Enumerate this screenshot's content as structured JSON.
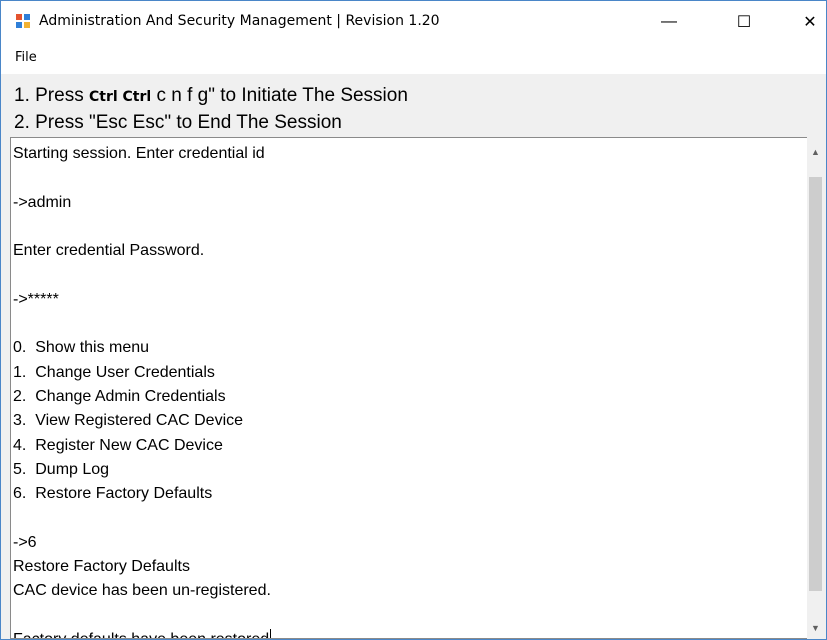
{
  "window": {
    "title": "Administration And Security Management  |  Revision 1.20",
    "icon": "app-window-icon",
    "controls": {
      "minimize": "—",
      "maximize": "☐",
      "close": "✕"
    }
  },
  "menu": {
    "file": "File"
  },
  "instructions": {
    "line1_prefix": "1. Press ",
    "line1_keys": "Ctrl Ctrl",
    "line1_suffix": " c n f g\" to Initiate The Session",
    "line2": "2. Press \"Esc Esc\" to End The Session"
  },
  "console": {
    "lines": [
      "Starting session. Enter credential id",
      "",
      "->admin",
      "",
      "Enter credential Password.",
      "",
      "->*****",
      "",
      "0.  Show this menu",
      "1.  Change User Credentials",
      "2.  Change Admin Credentials",
      "3.  View Registered CAC Device",
      "4.  Register New CAC Device",
      "5.  Dump Log",
      "6.  Restore Factory Defaults",
      "",
      "->6",
      "Restore Factory Defaults",
      "CAC device has been un-registered.",
      "",
      "Factory defaults have been restored"
    ]
  },
  "scrollbar": {
    "up_arrow": "▲",
    "down_arrow": "▼"
  },
  "colors": {
    "accent_border": "#4a86c8",
    "console_bg": "#ffffff"
  }
}
